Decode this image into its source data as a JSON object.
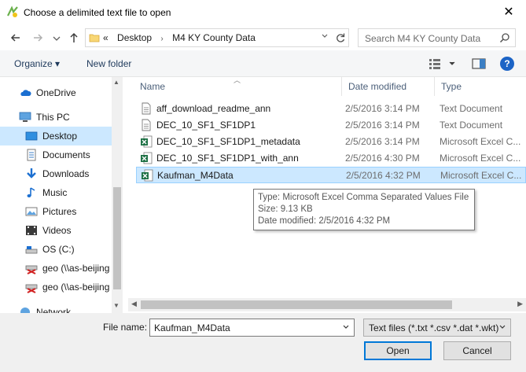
{
  "window": {
    "title": "Choose a delimited text file to open",
    "close": "✕"
  },
  "address": {
    "overflow": "«",
    "crumbs": [
      "Desktop",
      "M4 KY County Data"
    ],
    "separator": "›"
  },
  "search": {
    "placeholder": "Search M4 KY County Data"
  },
  "toolbar": {
    "organize": "Organize ▾",
    "new_folder": "New folder",
    "help": "?"
  },
  "sidebar": {
    "items": [
      {
        "label": "OneDrive",
        "icon": "cloud-icon"
      },
      {
        "label": "This PC",
        "icon": "computer-icon"
      },
      {
        "label": "Desktop",
        "icon": "desktop-icon",
        "selected": true
      },
      {
        "label": "Documents",
        "icon": "documents-icon"
      },
      {
        "label": "Downloads",
        "icon": "downloads-icon"
      },
      {
        "label": "Music",
        "icon": "music-icon"
      },
      {
        "label": "Pictures",
        "icon": "pictures-icon"
      },
      {
        "label": "Videos",
        "icon": "videos-icon"
      },
      {
        "label": "OS (C:)",
        "icon": "drive-icon"
      },
      {
        "label": "geo (\\\\as-beijing",
        "icon": "network-drive-icon"
      },
      {
        "label": "geo (\\\\as-beijing",
        "icon": "network-drive-icon"
      },
      {
        "label": "Network",
        "icon": "network-icon"
      }
    ]
  },
  "columns": {
    "name": "Name",
    "date": "Date modified",
    "type": "Type"
  },
  "files": [
    {
      "name": "aff_download_readme_ann",
      "date": "2/5/2016 3:14 PM",
      "type": "Text Document",
      "icon": "text-file-icon"
    },
    {
      "name": "DEC_10_SF1_SF1DP1",
      "date": "2/5/2016 3:14 PM",
      "type": "Text Document",
      "icon": "text-file-icon"
    },
    {
      "name": "DEC_10_SF1_SF1DP1_metadata",
      "date": "2/5/2016 3:14 PM",
      "type": "Microsoft Excel C...",
      "icon": "excel-file-icon"
    },
    {
      "name": "DEC_10_SF1_SF1DP1_with_ann",
      "date": "2/5/2016 4:30 PM",
      "type": "Microsoft Excel C...",
      "icon": "excel-file-icon"
    },
    {
      "name": "Kaufman_M4Data",
      "date": "2/5/2016 4:32 PM",
      "type": "Microsoft Excel C...",
      "icon": "excel-file-icon",
      "selected": true
    }
  ],
  "tooltip": {
    "type": "Type: Microsoft Excel Comma Separated Values File",
    "size": "Size: 9.13 KB",
    "modified": "Date modified: 2/5/2016 4:32 PM"
  },
  "bottom": {
    "file_name_label": "File name:",
    "file_name_value": "Kaufman_M4Data",
    "filter": "Text files (*.txt *.csv *.dat *.wkt)",
    "open": "Open",
    "cancel": "Cancel"
  },
  "colors": {
    "selection": "#cce8ff",
    "selection_border": "#99d1ff",
    "accent": "#0078d7"
  }
}
